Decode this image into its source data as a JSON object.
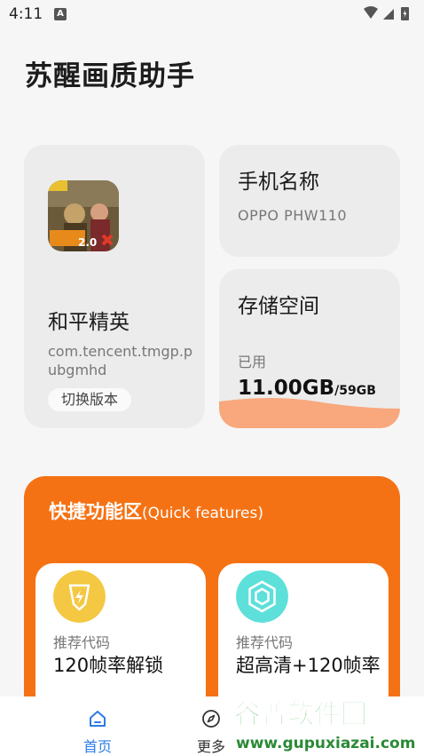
{
  "status_bar": {
    "time": "4:11",
    "notification_icon": "A"
  },
  "app_title": "苏醒画质助手",
  "game_card": {
    "name": "和平精英",
    "package": "com.tencent.tmgp.pubgmhd",
    "switch_button": "切换版本",
    "icon_badge": "2.0"
  },
  "phone_card": {
    "label": "手机名称",
    "model": "OPPO PHW110"
  },
  "storage_card": {
    "label": "存储空间",
    "used_label": "已用",
    "used_value": "11.00GB",
    "total_value": "/59GB",
    "fill_color": "#f9a77d"
  },
  "quick_features": {
    "title": "快捷功能区",
    "title_en": "(Quick features)",
    "accent": "#f57214",
    "items": [
      {
        "subtitle": "推荐代码",
        "title": "120帧率解锁",
        "icon": "lightning-icon",
        "icon_color": "#f4c842"
      },
      {
        "subtitle": "推荐代码",
        "title": "超高清+120帧率",
        "icon": "hexagon-icon",
        "icon_color": "#5ee0da"
      }
    ]
  },
  "bottom_nav": {
    "items": [
      {
        "label": "首页",
        "icon": "home-icon",
        "active": true
      },
      {
        "label": "更多",
        "icon": "compass-icon",
        "active": false
      }
    ],
    "active_color": "#2d7be5"
  },
  "watermark": {
    "brand": "谷普软件园",
    "url": "www.gupuxiazai.com"
  }
}
